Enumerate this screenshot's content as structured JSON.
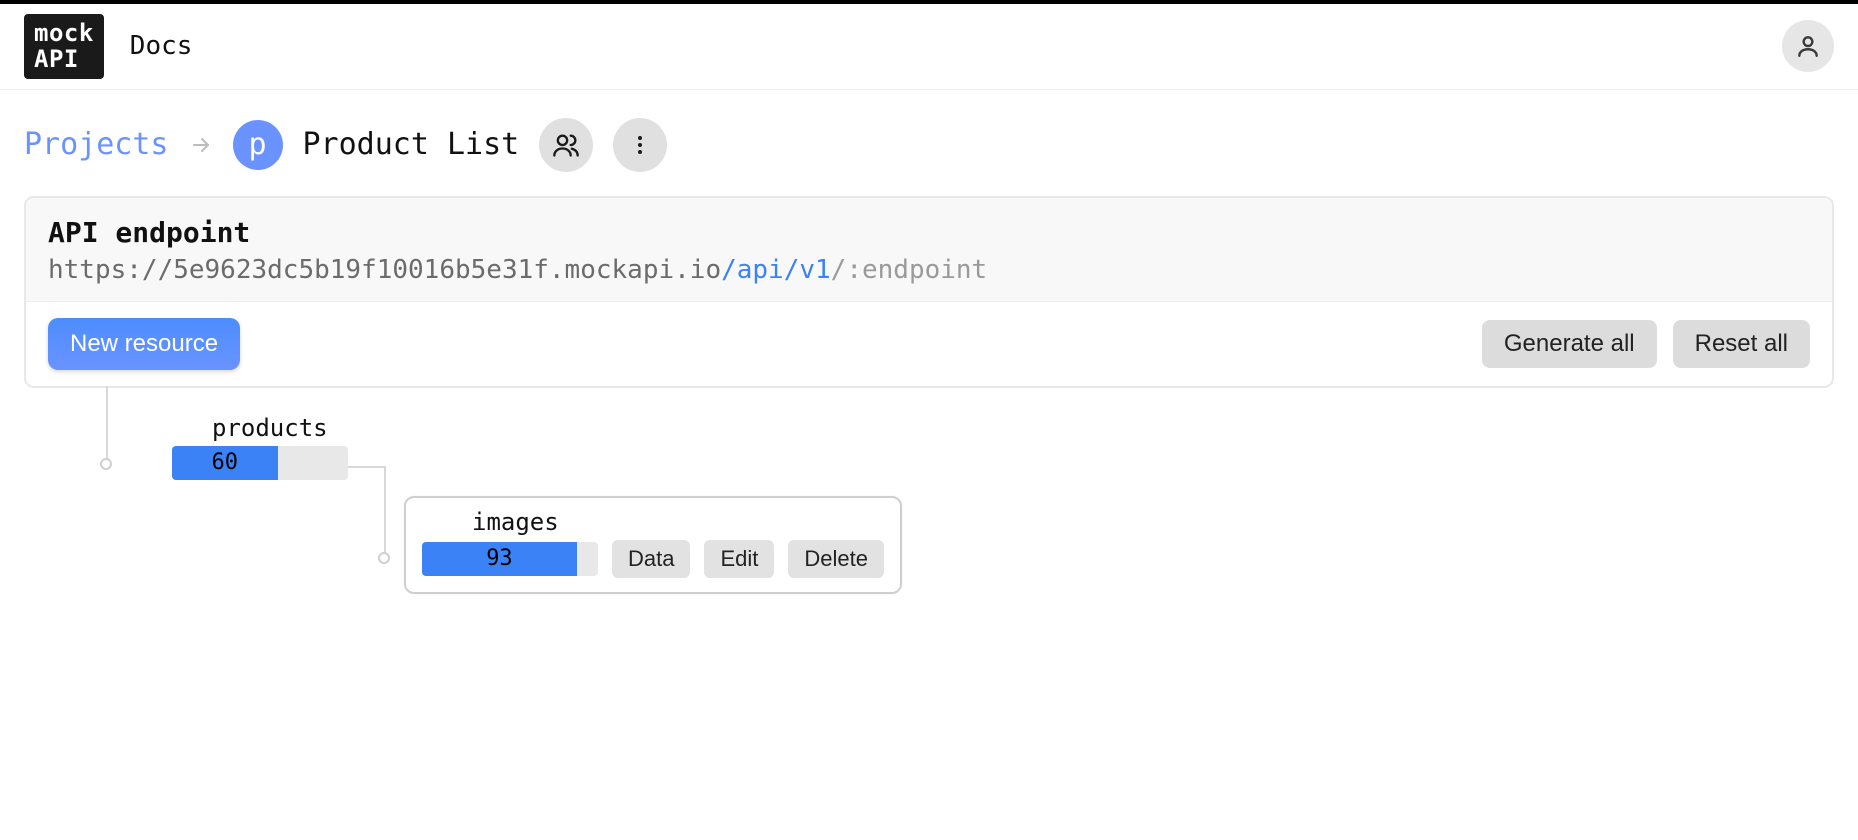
{
  "logo": {
    "line1": "mock",
    "line2": "API"
  },
  "nav": {
    "docs": "Docs"
  },
  "breadcrumb": {
    "root": "Projects",
    "project_initial": "p",
    "project_name": "Product List"
  },
  "panel": {
    "title": "API endpoint",
    "endpoint_base": "https://5e9623dc5b19f10016b5e31f.mockapi.io",
    "endpoint_path": "/api/v1",
    "endpoint_suffix": "/:endpoint",
    "new_resource_label": "New resource",
    "generate_all_label": "Generate all",
    "reset_all_label": "Reset all"
  },
  "resources": {
    "products": {
      "name": "products",
      "count": 60,
      "fill_pct": 60
    },
    "images": {
      "name": "images",
      "count": 93,
      "fill_pct": 88,
      "actions": {
        "data": "Data",
        "edit": "Edit",
        "delete": "Delete"
      }
    }
  }
}
